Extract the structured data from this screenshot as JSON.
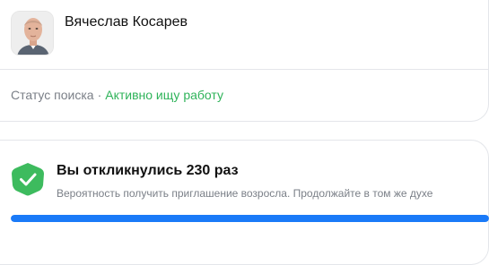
{
  "profile": {
    "name": "Вячеслав Косарев",
    "avatar_icon": "user-photo"
  },
  "search_status": {
    "label": "Статус поиска",
    "separator": "·",
    "value": "Активно ищу работу",
    "value_color": "#2fb35a"
  },
  "responses": {
    "title": "Вы откликнулись 230 раз",
    "subtitle": "Вероятность получить приглашение возросла. Продолжайте в том же духе",
    "badge_icon": "check-icon",
    "badge_color": "#3dbb5e",
    "progress_fraction": 1.0,
    "progress_color": "#1a7af8"
  }
}
